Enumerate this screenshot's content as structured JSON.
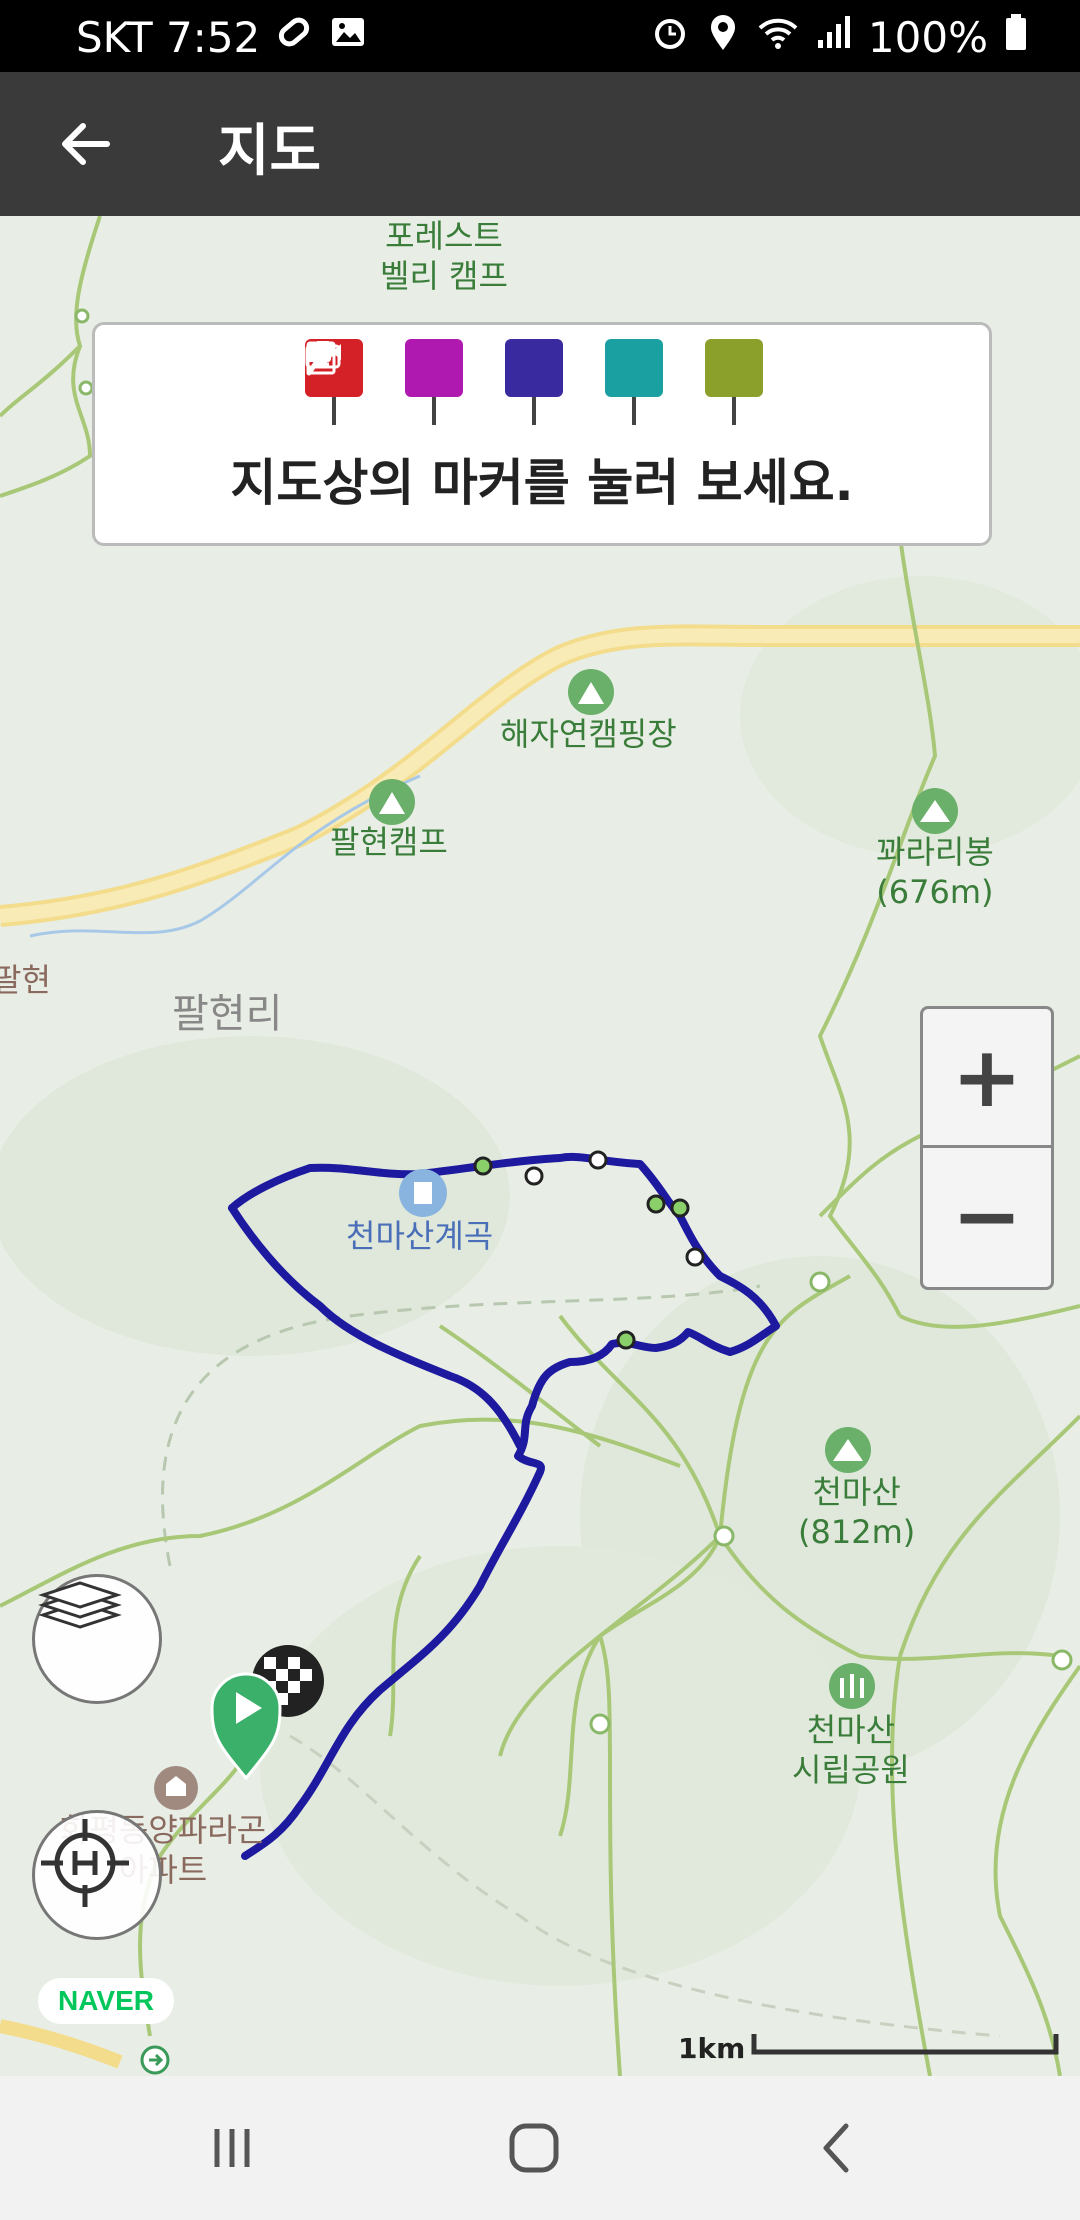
{
  "status_bar": {
    "carrier_time": "SKT 7:52",
    "battery": "100%",
    "icons": [
      "link-icon",
      "image-icon",
      "alarm-icon",
      "location-icon",
      "wifi-icon",
      "signal-icon",
      "battery-icon"
    ]
  },
  "app_bar": {
    "title": "지도",
    "back_icon": "arrow-left-icon"
  },
  "marker_panel": {
    "markers": [
      {
        "name": "direction-marker",
        "icon": "navigation-icon",
        "color": "#d42027"
      },
      {
        "name": "photo-marker",
        "icon": "camera-icon",
        "color": "#b019b0"
      },
      {
        "name": "video-marker",
        "icon": "video-icon",
        "color": "#3a2aa0"
      },
      {
        "name": "voice-marker",
        "icon": "microphone-icon",
        "color": "#1aa0a0"
      },
      {
        "name": "memo-marker",
        "icon": "notepad-icon",
        "color": "#8aa02a"
      }
    ],
    "hint": "지도상의 마커를 눌러 보세요."
  },
  "map": {
    "labels": {
      "forest_valley_camp": "포레스트\n벨리 캠프",
      "haejayeon_camping": "해자연캠핑장",
      "palhyeon_camp": "팔현캠프",
      "kkwarari_peak": "꽈라리봉\n(676m)",
      "palhyeon_edge": "팔현",
      "palhyeonri": "팔현리",
      "cheonmasan_valley": "천마산계곡",
      "cheonmasan": "천마산\n(812m)",
      "cheonmasan_park": "천마산\n시립공원",
      "apartment": "화평동양파라곤\n아파트"
    },
    "track_color": "#1e1aa0",
    "scale": "1km"
  },
  "zoom": {
    "in": "+",
    "out": "−"
  },
  "buttons": {
    "layers_icon": "layers-icon",
    "location_icon": "heli-target-icon"
  },
  "attribution": "NAVER",
  "nav_bar": {
    "recents_icon": "recents-icon",
    "home_icon": "home-icon",
    "back_icon": "back-chevron-icon"
  }
}
